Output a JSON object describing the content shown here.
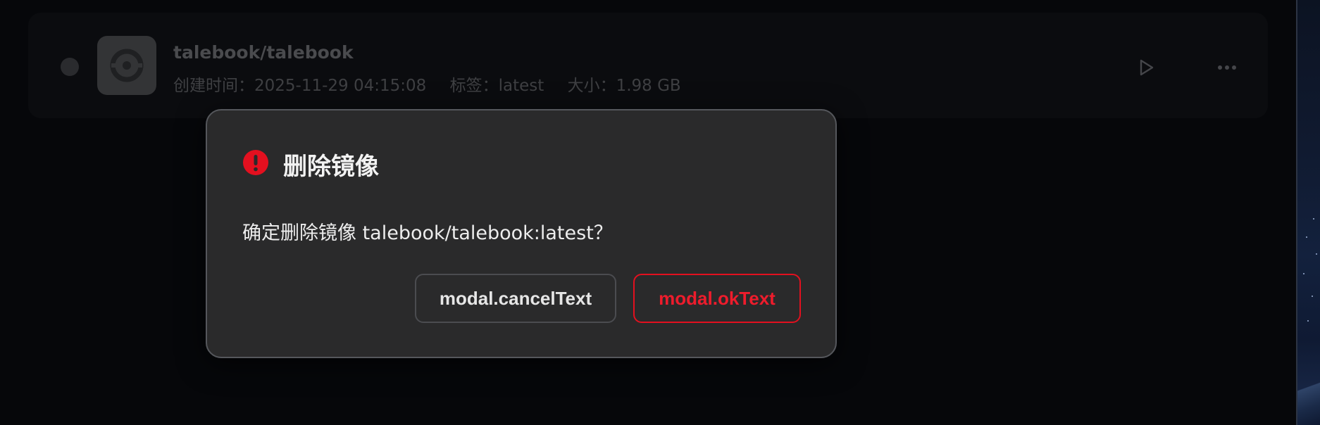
{
  "image_row": {
    "title": "talebook/talebook",
    "created_label": "创建时间：2025-11-29 04:15:08",
    "tag_label": "标签：latest",
    "size_label": "大小：1.98 GB",
    "status_icon": "status-dot",
    "avatar_icon": "app-logo-icon",
    "actions": [
      "play-icon",
      "more-icon"
    ]
  },
  "modal": {
    "title": "删除镜像",
    "message": "确定删除镜像 talebook/talebook:latest？",
    "icon": "exclamation-circle-icon",
    "cancel_label": "modal.cancelText",
    "ok_label": "modal.okText"
  },
  "colors": {
    "danger": "#e3101f",
    "modal_bg": "#2a2a2b",
    "page_bg": "#06070a"
  }
}
